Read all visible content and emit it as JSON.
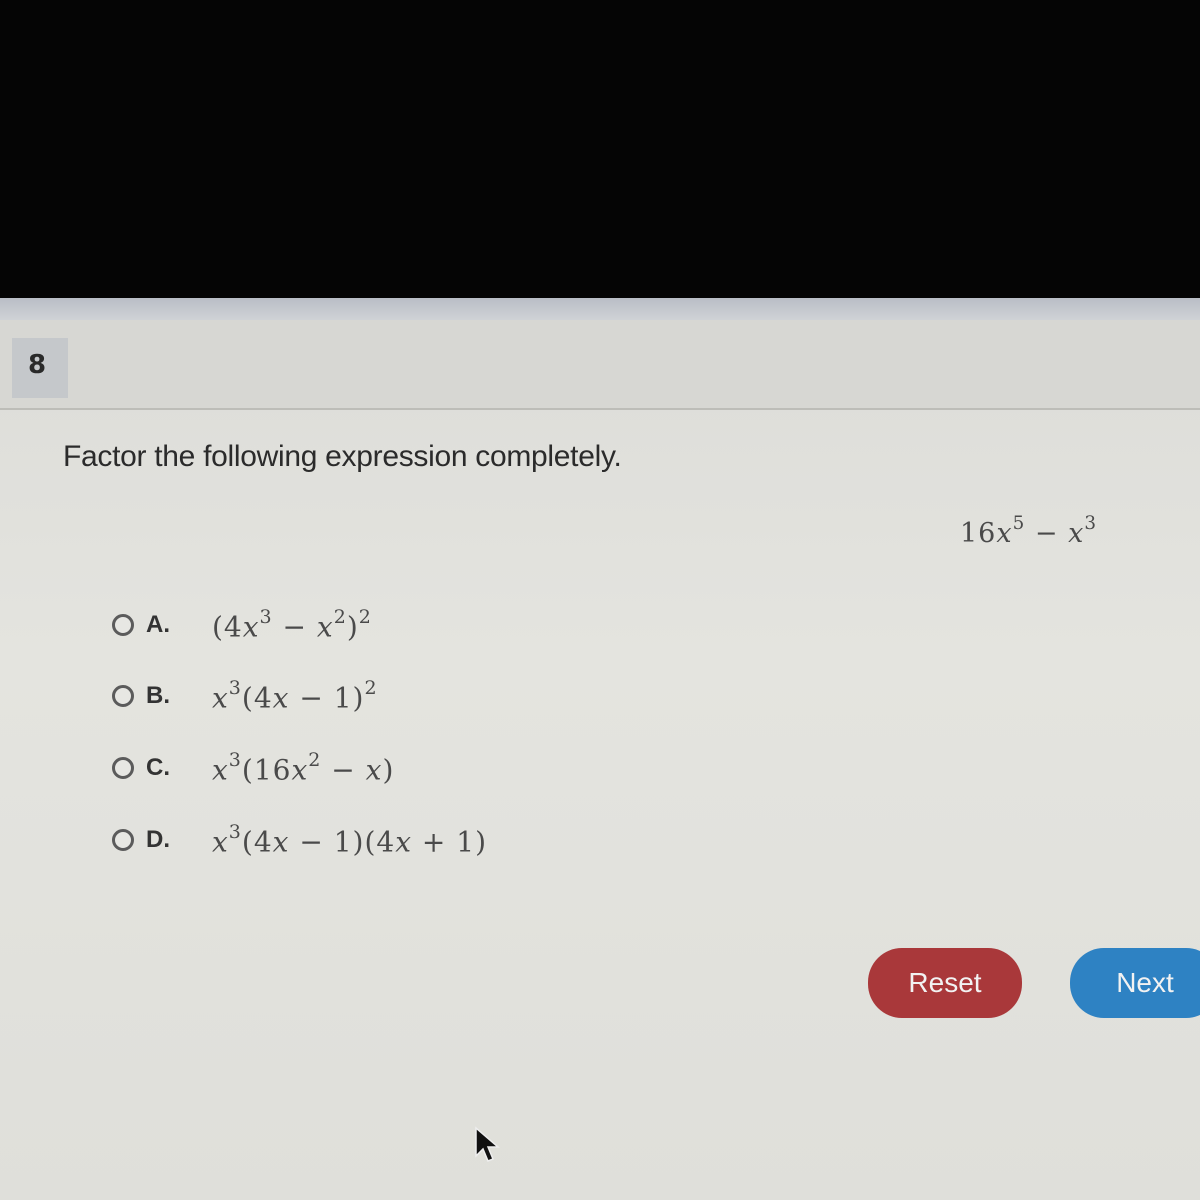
{
  "question": {
    "number": "8",
    "prompt": "Factor the following expression completely.",
    "expression": {
      "coef": "16",
      "var": "x",
      "exp1": "5",
      "op": "−",
      "var2": "x",
      "exp2": "3"
    }
  },
  "choices": [
    {
      "letter": "A.",
      "parts": [
        "(4",
        "x",
        "3",
        " − ",
        "x",
        "2",
        ")",
        "2"
      ]
    },
    {
      "letter": "B.",
      "text_pre": "",
      "var": "x",
      "exp": "3",
      "rest_a": "(4",
      "var2": "x",
      "rest_b": " − 1)",
      "exp2": "2"
    },
    {
      "letter": "C.",
      "var": "x",
      "exp": "3",
      "rest_a": "(16",
      "var2": "x",
      "exp2": "2",
      "rest_b": " − ",
      "var3": "x",
      "rest_c": ")"
    },
    {
      "letter": "D.",
      "var": "x",
      "exp": "3",
      "rest_a": "(4",
      "var2": "x",
      "rest_b": " − 1)(4",
      "var3": "x",
      "rest_c": " + 1)"
    }
  ],
  "buttons": {
    "reset": "Reset",
    "next": "Next"
  },
  "colors": {
    "reset": "#a9383a",
    "next": "#2e82c3"
  }
}
